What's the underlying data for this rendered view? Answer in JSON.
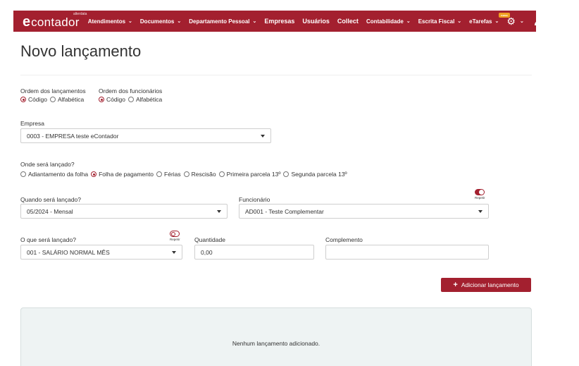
{
  "navbar": {
    "logo_e": "e",
    "logo_text": "contador",
    "logo_sup": "alterdata",
    "items": [
      {
        "label": "Atendimentos",
        "chevron": true
      },
      {
        "label": "Documentos",
        "chevron": true
      },
      {
        "label": "Departamento Pessoal",
        "chevron": true
      },
      {
        "label": "Empresas",
        "chevron": false
      },
      {
        "label": "Usuários",
        "chevron": false
      },
      {
        "label": "Collect",
        "chevron": false
      },
      {
        "label": "Contabilidade",
        "chevron": true
      },
      {
        "label": "Escrita Fiscal",
        "chevron": true
      },
      {
        "label": "eTarefas",
        "chevron": true
      }
    ],
    "etarefas_badge": "novo",
    "chevron_glyph": "⌄",
    "settings_icon": "gear-icon",
    "user_icon": "user-icon"
  },
  "page": {
    "title": "Novo lançamento"
  },
  "ordem": {
    "lancamentos_label": "Ordem dos lançamentos",
    "lancamentos_options": [
      "Código",
      "Alfabética"
    ],
    "funcionarios_label": "Ordem dos funcionários",
    "funcionarios_options": [
      "Código",
      "Alfabética"
    ],
    "selected": "Código"
  },
  "empresa": {
    "label": "Empresa",
    "value": "0003 - EMPRESA teste eContador"
  },
  "onde": {
    "label": "Onde será lançado?",
    "options": [
      "Adiantamento da folha",
      "Folha de pagamento",
      "Férias",
      "Rescisão",
      "Primeira parcela 13º",
      "Segunda parcela 13º"
    ],
    "selected": "Folha de pagamento"
  },
  "quando": {
    "label": "Quando será lançado?",
    "value": "05/2024 - Mensal"
  },
  "funcionario": {
    "label": "Funcionário",
    "value": "AD001 - Teste Complementar",
    "repetir_label": "Repetir",
    "repetir_on": true
  },
  "oque": {
    "label": "O que será lançado?",
    "value": "001 - SALÁRIO NORMAL MÊS",
    "repetir_label": "Repetir",
    "repetir_on": false
  },
  "quantidade": {
    "label": "Quantidade",
    "value": "0,00"
  },
  "complemento": {
    "label": "Complemento",
    "value": ""
  },
  "add_button": {
    "icon": "+",
    "label": "Adicionar lançamento"
  },
  "lancamentos": {
    "empty_text": "Nenhum lançamento adicionado."
  },
  "colors": {
    "brand": "#a3202f",
    "panel_bg": "#eef3f3"
  }
}
